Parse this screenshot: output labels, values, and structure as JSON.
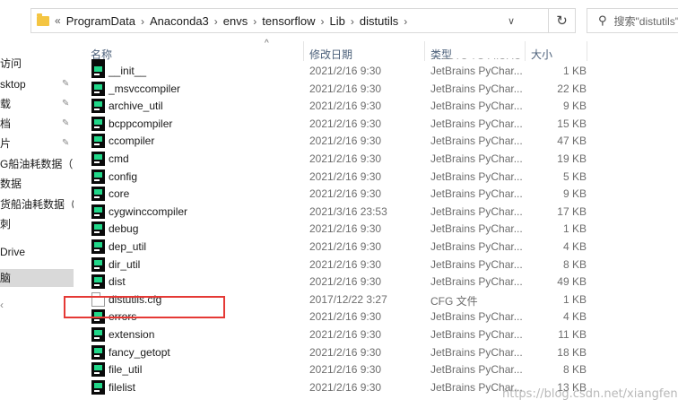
{
  "address": {
    "prefix": "«",
    "crumbs": [
      "ProgramData",
      "Anaconda3",
      "envs",
      "tensorflow",
      "Lib",
      "distutils"
    ],
    "separator": "›",
    "dropdown": "∨",
    "refresh": "↻"
  },
  "search": {
    "placeholder": "搜索\"distutils\""
  },
  "nav": {
    "items": [
      "访问",
      "sktop",
      "载",
      "档",
      "片",
      "G船油耗数据（装",
      "数据",
      "货船油耗数据（日",
      "刺",
      "Drive",
      "脑",
      "‹"
    ]
  },
  "columns": {
    "name": "名称",
    "date": "修改日期",
    "type": "类型",
    "size": "大小",
    "sort_arrow": "^"
  },
  "partial_row": {
    "type": "IIFLUTU YO FIIUI IU"
  },
  "files": [
    {
      "name": "__init__",
      "date": "2021/2/16 9:30",
      "type": "JetBrains PyChar...",
      "size": "1 KB",
      "icon": "pycharm-icon"
    },
    {
      "name": "_msvccompiler",
      "date": "2021/2/16 9:30",
      "type": "JetBrains PyChar...",
      "size": "22 KB",
      "icon": "pycharm-icon"
    },
    {
      "name": "archive_util",
      "date": "2021/2/16 9:30",
      "type": "JetBrains PyChar...",
      "size": "9 KB",
      "icon": "pycharm-icon"
    },
    {
      "name": "bcppcompiler",
      "date": "2021/2/16 9:30",
      "type": "JetBrains PyChar...",
      "size": "15 KB",
      "icon": "pycharm-icon"
    },
    {
      "name": "ccompiler",
      "date": "2021/2/16 9:30",
      "type": "JetBrains PyChar...",
      "size": "47 KB",
      "icon": "pycharm-icon"
    },
    {
      "name": "cmd",
      "date": "2021/2/16 9:30",
      "type": "JetBrains PyChar...",
      "size": "19 KB",
      "icon": "pycharm-icon"
    },
    {
      "name": "config",
      "date": "2021/2/16 9:30",
      "type": "JetBrains PyChar...",
      "size": "5 KB",
      "icon": "pycharm-icon"
    },
    {
      "name": "core",
      "date": "2021/2/16 9:30",
      "type": "JetBrains PyChar...",
      "size": "9 KB",
      "icon": "pycharm-icon"
    },
    {
      "name": "cygwinccompiler",
      "date": "2021/3/16 23:53",
      "type": "JetBrains PyChar...",
      "size": "17 KB",
      "icon": "pycharm-icon"
    },
    {
      "name": "debug",
      "date": "2021/2/16 9:30",
      "type": "JetBrains PyChar...",
      "size": "1 KB",
      "icon": "pycharm-icon"
    },
    {
      "name": "dep_util",
      "date": "2021/2/16 9:30",
      "type": "JetBrains PyChar...",
      "size": "4 KB",
      "icon": "pycharm-icon"
    },
    {
      "name": "dir_util",
      "date": "2021/2/16 9:30",
      "type": "JetBrains PyChar...",
      "size": "8 KB",
      "icon": "pycharm-icon"
    },
    {
      "name": "dist",
      "date": "2021/2/16 9:30",
      "type": "JetBrains PyChar...",
      "size": "49 KB",
      "icon": "pycharm-icon"
    },
    {
      "name": "distutils.cfg",
      "date": "2017/12/22 3:27",
      "type": "CFG 文件",
      "size": "1 KB",
      "icon": "file-icon"
    },
    {
      "name": "errors",
      "date": "2021/2/16 9:30",
      "type": "JetBrains PyChar...",
      "size": "4 KB",
      "icon": "pycharm-icon"
    },
    {
      "name": "extension",
      "date": "2021/2/16 9:30",
      "type": "JetBrains PyChar...",
      "size": "11 KB",
      "icon": "pycharm-icon"
    },
    {
      "name": "fancy_getopt",
      "date": "2021/2/16 9:30",
      "type": "JetBrains PyChar...",
      "size": "18 KB",
      "icon": "pycharm-icon"
    },
    {
      "name": "file_util",
      "date": "2021/2/16 9:30",
      "type": "JetBrains PyChar...",
      "size": "8 KB",
      "icon": "pycharm-icon"
    },
    {
      "name": "filelist",
      "date": "2021/2/16 9:30",
      "type": "JetBrains PyChar...",
      "size": "13 KB",
      "icon": "pycharm-icon"
    }
  ],
  "watermark": "https://blog.csdn.net/xiangfengl",
  "colors": {
    "highlight": "#e53935",
    "pycharm_green": "#21d789",
    "folder": "#f4c542"
  }
}
